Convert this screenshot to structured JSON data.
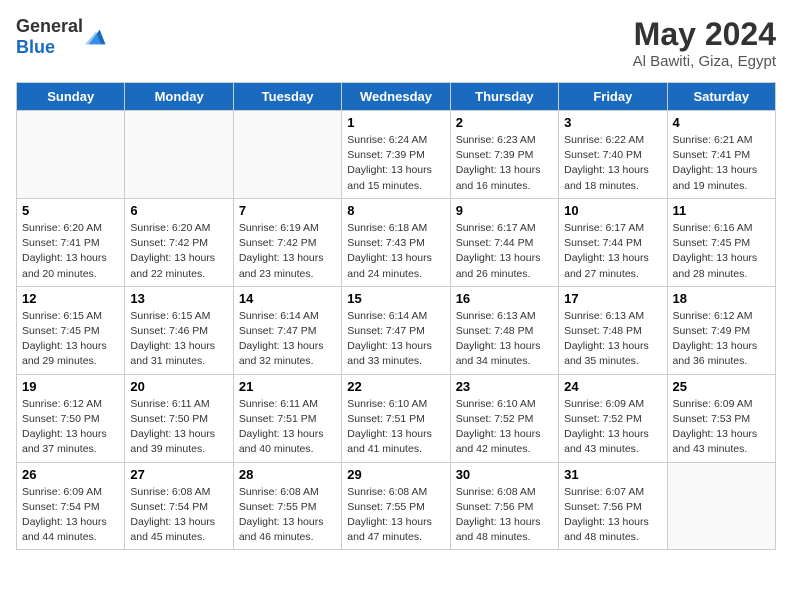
{
  "header": {
    "logo_general": "General",
    "logo_blue": "Blue",
    "month_year": "May 2024",
    "location": "Al Bawiti, Giza, Egypt"
  },
  "weekdays": [
    "Sunday",
    "Monday",
    "Tuesday",
    "Wednesday",
    "Thursday",
    "Friday",
    "Saturday"
  ],
  "weeks": [
    [
      {
        "day": "",
        "info": ""
      },
      {
        "day": "",
        "info": ""
      },
      {
        "day": "",
        "info": ""
      },
      {
        "day": "1",
        "info": "Sunrise: 6:24 AM\nSunset: 7:39 PM\nDaylight: 13 hours and 15 minutes."
      },
      {
        "day": "2",
        "info": "Sunrise: 6:23 AM\nSunset: 7:39 PM\nDaylight: 13 hours and 16 minutes."
      },
      {
        "day": "3",
        "info": "Sunrise: 6:22 AM\nSunset: 7:40 PM\nDaylight: 13 hours and 18 minutes."
      },
      {
        "day": "4",
        "info": "Sunrise: 6:21 AM\nSunset: 7:41 PM\nDaylight: 13 hours and 19 minutes."
      }
    ],
    [
      {
        "day": "5",
        "info": "Sunrise: 6:20 AM\nSunset: 7:41 PM\nDaylight: 13 hours and 20 minutes."
      },
      {
        "day": "6",
        "info": "Sunrise: 6:20 AM\nSunset: 7:42 PM\nDaylight: 13 hours and 22 minutes."
      },
      {
        "day": "7",
        "info": "Sunrise: 6:19 AM\nSunset: 7:42 PM\nDaylight: 13 hours and 23 minutes."
      },
      {
        "day": "8",
        "info": "Sunrise: 6:18 AM\nSunset: 7:43 PM\nDaylight: 13 hours and 24 minutes."
      },
      {
        "day": "9",
        "info": "Sunrise: 6:17 AM\nSunset: 7:44 PM\nDaylight: 13 hours and 26 minutes."
      },
      {
        "day": "10",
        "info": "Sunrise: 6:17 AM\nSunset: 7:44 PM\nDaylight: 13 hours and 27 minutes."
      },
      {
        "day": "11",
        "info": "Sunrise: 6:16 AM\nSunset: 7:45 PM\nDaylight: 13 hours and 28 minutes."
      }
    ],
    [
      {
        "day": "12",
        "info": "Sunrise: 6:15 AM\nSunset: 7:45 PM\nDaylight: 13 hours and 29 minutes."
      },
      {
        "day": "13",
        "info": "Sunrise: 6:15 AM\nSunset: 7:46 PM\nDaylight: 13 hours and 31 minutes."
      },
      {
        "day": "14",
        "info": "Sunrise: 6:14 AM\nSunset: 7:47 PM\nDaylight: 13 hours and 32 minutes."
      },
      {
        "day": "15",
        "info": "Sunrise: 6:14 AM\nSunset: 7:47 PM\nDaylight: 13 hours and 33 minutes."
      },
      {
        "day": "16",
        "info": "Sunrise: 6:13 AM\nSunset: 7:48 PM\nDaylight: 13 hours and 34 minutes."
      },
      {
        "day": "17",
        "info": "Sunrise: 6:13 AM\nSunset: 7:48 PM\nDaylight: 13 hours and 35 minutes."
      },
      {
        "day": "18",
        "info": "Sunrise: 6:12 AM\nSunset: 7:49 PM\nDaylight: 13 hours and 36 minutes."
      }
    ],
    [
      {
        "day": "19",
        "info": "Sunrise: 6:12 AM\nSunset: 7:50 PM\nDaylight: 13 hours and 37 minutes."
      },
      {
        "day": "20",
        "info": "Sunrise: 6:11 AM\nSunset: 7:50 PM\nDaylight: 13 hours and 39 minutes."
      },
      {
        "day": "21",
        "info": "Sunrise: 6:11 AM\nSunset: 7:51 PM\nDaylight: 13 hours and 40 minutes."
      },
      {
        "day": "22",
        "info": "Sunrise: 6:10 AM\nSunset: 7:51 PM\nDaylight: 13 hours and 41 minutes."
      },
      {
        "day": "23",
        "info": "Sunrise: 6:10 AM\nSunset: 7:52 PM\nDaylight: 13 hours and 42 minutes."
      },
      {
        "day": "24",
        "info": "Sunrise: 6:09 AM\nSunset: 7:52 PM\nDaylight: 13 hours and 43 minutes."
      },
      {
        "day": "25",
        "info": "Sunrise: 6:09 AM\nSunset: 7:53 PM\nDaylight: 13 hours and 43 minutes."
      }
    ],
    [
      {
        "day": "26",
        "info": "Sunrise: 6:09 AM\nSunset: 7:54 PM\nDaylight: 13 hours and 44 minutes."
      },
      {
        "day": "27",
        "info": "Sunrise: 6:08 AM\nSunset: 7:54 PM\nDaylight: 13 hours and 45 minutes."
      },
      {
        "day": "28",
        "info": "Sunrise: 6:08 AM\nSunset: 7:55 PM\nDaylight: 13 hours and 46 minutes."
      },
      {
        "day": "29",
        "info": "Sunrise: 6:08 AM\nSunset: 7:55 PM\nDaylight: 13 hours and 47 minutes."
      },
      {
        "day": "30",
        "info": "Sunrise: 6:08 AM\nSunset: 7:56 PM\nDaylight: 13 hours and 48 minutes."
      },
      {
        "day": "31",
        "info": "Sunrise: 6:07 AM\nSunset: 7:56 PM\nDaylight: 13 hours and 48 minutes."
      },
      {
        "day": "",
        "info": ""
      }
    ]
  ]
}
